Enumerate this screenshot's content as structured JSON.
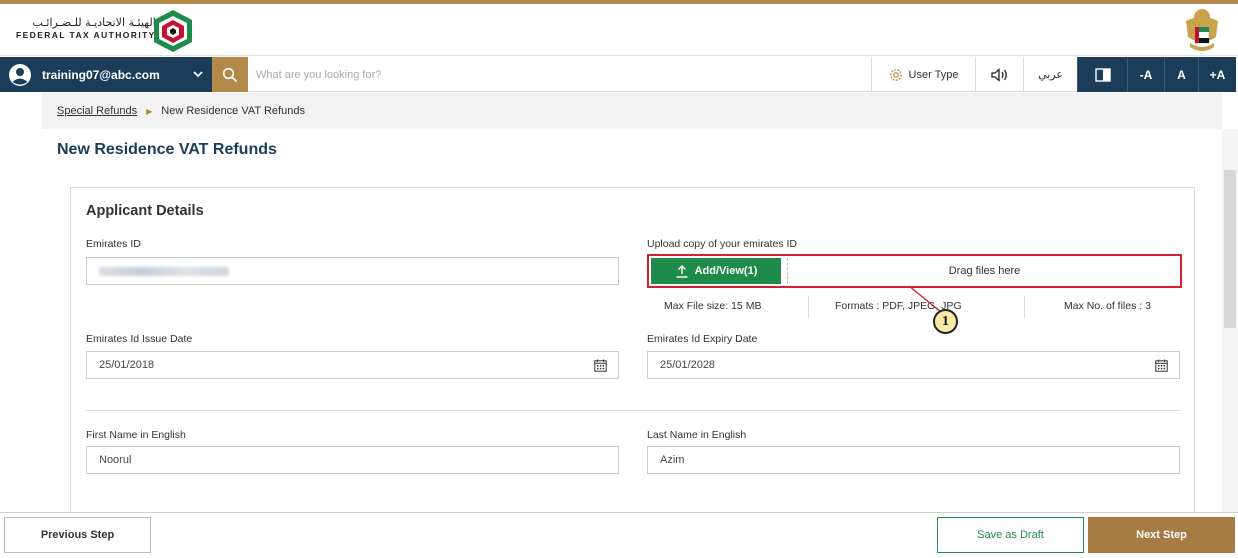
{
  "header": {
    "org_name_arabic": "الهيئـة الاتحاديـة للـضـرائـب",
    "org_name_english": "FEDERAL TAX AUTHORITY",
    "logo_icon": "fta-logo-icon",
    "emblem_icon": "uae-emblem-icon"
  },
  "navbar": {
    "user_email": "training07@abc.com",
    "search_placeholder": "What are you looking for?",
    "user_type_label": "User Type",
    "arabic_label": "عربي",
    "font_decrease_label": "-A",
    "font_normal_label": "A",
    "font_increase_label": "+A"
  },
  "breadcrumb": {
    "parent": "Special Refunds",
    "current": "New Residence VAT Refunds"
  },
  "page": {
    "title": "New Residence VAT Refunds"
  },
  "form": {
    "section_title": "Applicant Details",
    "emirates_id_label": "Emirates ID",
    "upload_label": "Upload copy of your emirates ID",
    "upload_button": "Add/View(1)",
    "upload_drag": "Drag files here",
    "max_file_size": "Max File size: 15 MB",
    "formats": "Formats : PDF, JPEG, JPG",
    "max_files": "Max No. of files : 3",
    "issue_date_label": "Emirates Id Issue Date",
    "issue_date_value": "25/01/2018",
    "expiry_date_label": "Emirates Id Expiry Date",
    "expiry_date_value": "25/01/2028",
    "first_name_label": "First Name in English",
    "first_name_value": "Noorul",
    "last_name_label": "Last Name in English",
    "last_name_value": "Azim"
  },
  "annotation": {
    "marker_number": "1"
  },
  "footer": {
    "previous_label": "Previous Step",
    "draft_label": "Save as Draft",
    "next_label": "Next Step"
  },
  "colors": {
    "navy": "#1b3d5a",
    "gold": "#b3894a",
    "green": "#1e8b4a",
    "highlight_red": "#d6202d"
  }
}
